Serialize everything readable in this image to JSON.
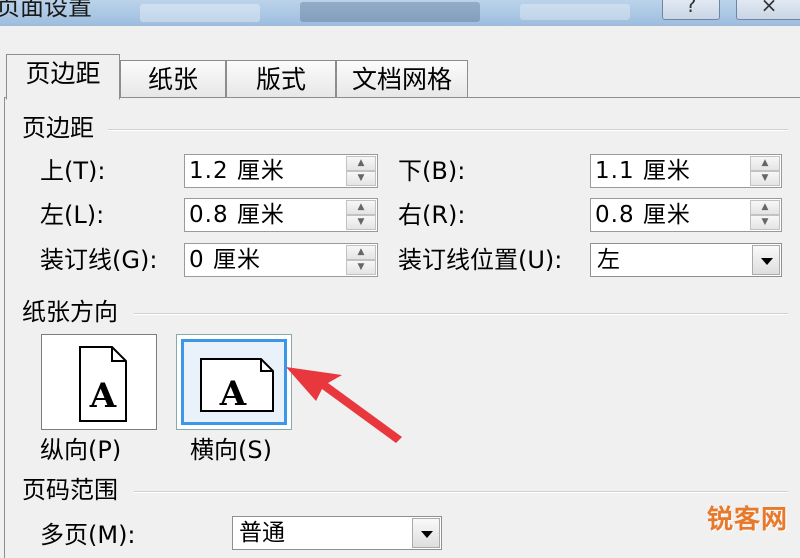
{
  "window": {
    "title": "页面设置",
    "help_label": "?",
    "close_label": "×"
  },
  "tabs": [
    {
      "label": "页边距",
      "active": true
    },
    {
      "label": "纸张",
      "active": false
    },
    {
      "label": "版式",
      "active": false
    },
    {
      "label": "文档网格",
      "active": false
    }
  ],
  "margins": {
    "heading": "页边距",
    "top": {
      "label": "上(T):",
      "value": "1.2 厘米"
    },
    "bottom": {
      "label": "下(B):",
      "value": "1.1 厘米"
    },
    "left": {
      "label": "左(L):",
      "value": "0.8 厘米"
    },
    "right": {
      "label": "右(R):",
      "value": "0.8 厘米"
    },
    "gutter": {
      "label": "装订线(G):",
      "value": "0 厘米"
    },
    "gutter_position": {
      "label": "装订线位置(U):",
      "value": "左"
    }
  },
  "orientation": {
    "heading": "纸张方向",
    "portrait": {
      "label": "纵向(P)",
      "icon_letter": "A"
    },
    "landscape": {
      "label": "横向(S)",
      "icon_letter": "A",
      "selected": true
    }
  },
  "pages": {
    "heading": "页码范围",
    "multiple_pages": {
      "label": "多页(M):",
      "value": "普通"
    }
  },
  "watermark": "锐客网",
  "colors": {
    "selection_border": "#3c97e6",
    "annotation_arrow": "#e8383d",
    "watermark": "#e8792a"
  }
}
